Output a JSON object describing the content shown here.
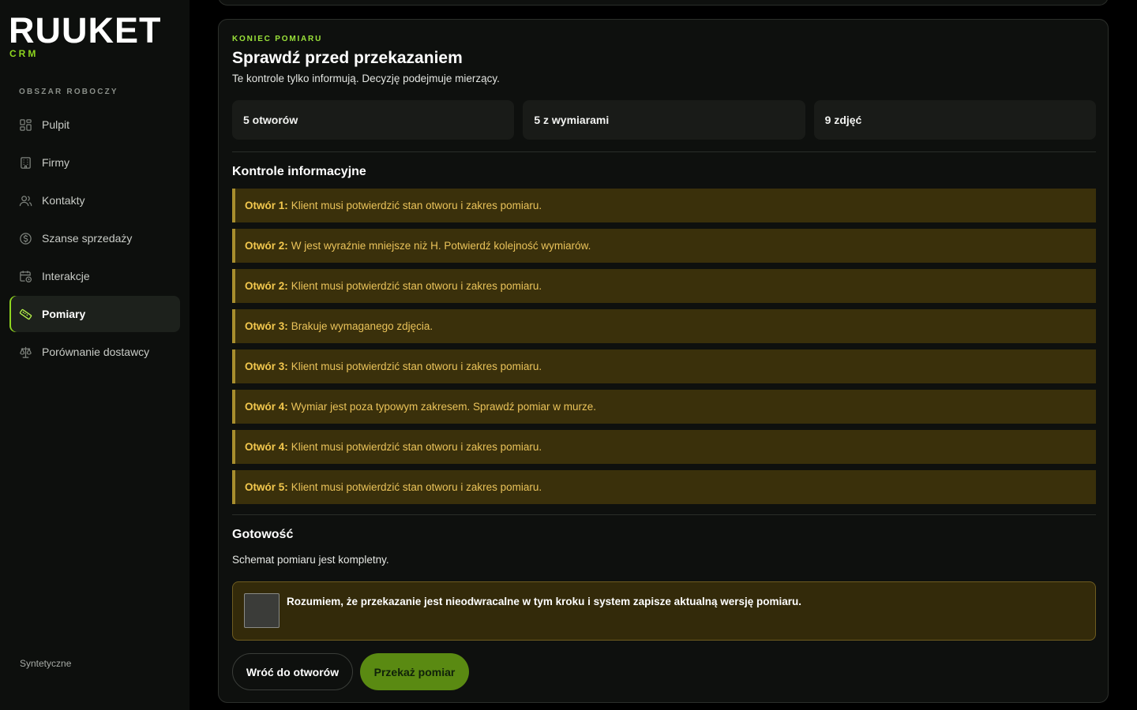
{
  "brand": {
    "logo_text": "RUUKET",
    "sub_label": "CRM",
    "accent_color": "#8fd61f"
  },
  "sidebar": {
    "section_label": "OBSZAR ROBOCZY",
    "items": [
      {
        "label": "Pulpit",
        "icon": "grid-icon",
        "active": false
      },
      {
        "label": "Firmy",
        "icon": "building-icon",
        "active": false
      },
      {
        "label": "Kontakty",
        "icon": "users-icon",
        "active": false
      },
      {
        "label": "Szanse sprzedaży",
        "icon": "dollar-circle-icon",
        "active": false
      },
      {
        "label": "Interakcje",
        "icon": "calendar-clock-icon",
        "active": false
      },
      {
        "label": "Pomiary",
        "icon": "ruler-icon",
        "active": true
      },
      {
        "label": "Porównanie dostawcy",
        "icon": "scale-icon",
        "active": false
      }
    ],
    "footer": "Syntetyczne"
  },
  "main": {
    "eyebrow": "KONIEC POMIARU",
    "title": "Sprawdź przed przekazaniem",
    "subtitle": "Te kontrole tylko informują. Decyzję podejmuje mierzący.",
    "stats": [
      {
        "label": "5 otworów"
      },
      {
        "label": "5 z wymiarami"
      },
      {
        "label": "9 zdjęć"
      }
    ],
    "checks_heading": "Kontrole informacyjne",
    "checks": [
      {
        "prefix": "Otwór 1:",
        "text": "Klient musi potwierdzić stan otworu i zakres pomiaru."
      },
      {
        "prefix": "Otwór 2:",
        "text": "W jest wyraźnie mniejsze niż H. Potwierdź kolejność wymiarów."
      },
      {
        "prefix": "Otwór 2:",
        "text": "Klient musi potwierdzić stan otworu i zakres pomiaru."
      },
      {
        "prefix": "Otwór 3:",
        "text": "Brakuje wymaganego zdjęcia."
      },
      {
        "prefix": "Otwór 3:",
        "text": "Klient musi potwierdzić stan otworu i zakres pomiaru."
      },
      {
        "prefix": "Otwór 4:",
        "text": "Wymiar jest poza typowym zakresem. Sprawdź pomiar w murze."
      },
      {
        "prefix": "Otwór 4:",
        "text": "Klient musi potwierdzić stan otworu i zakres pomiaru."
      },
      {
        "prefix": "Otwór 5:",
        "text": "Klient musi potwierdzić stan otworu i zakres pomiaru."
      }
    ],
    "readiness_heading": "Gotowość",
    "readiness_text": "Schemat pomiaru jest kompletny.",
    "confirm_text": "Rozumiem, że przekazanie jest nieodwracalne w tym kroku i system zapisze aktualną wersję pomiaru.",
    "confirm_checked": false,
    "back_button": "Wróć do otworów",
    "submit_button": "Przekaż pomiar"
  }
}
